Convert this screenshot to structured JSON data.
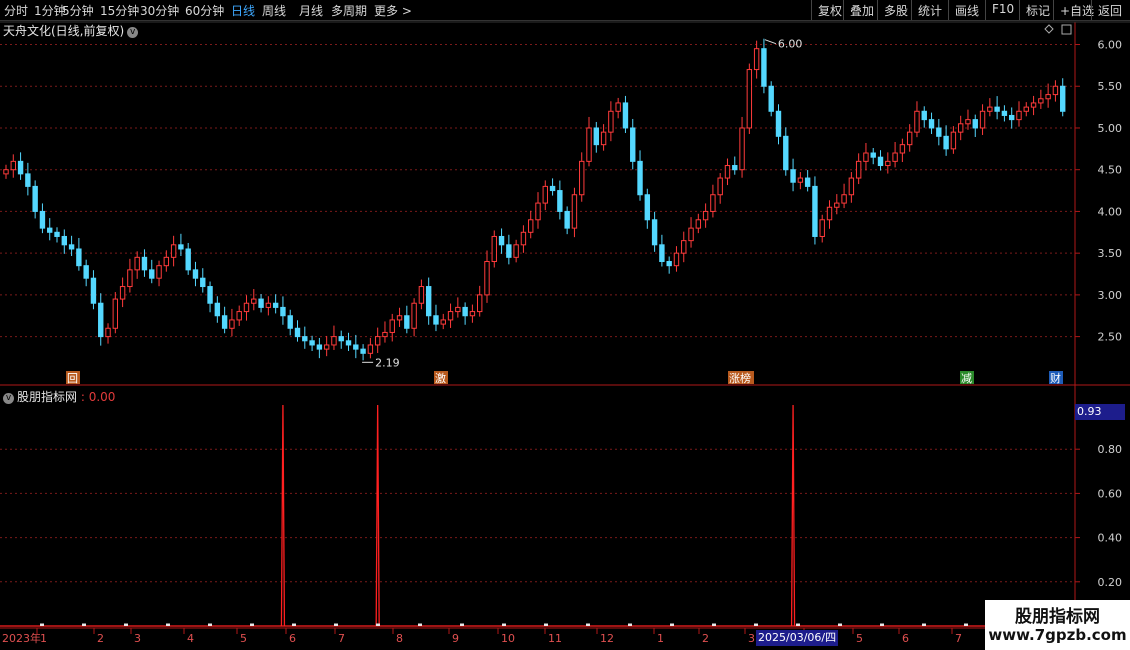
{
  "toolbar": {
    "left": [
      "分时",
      "1分钟",
      "5分钟",
      "15分钟",
      "30分钟",
      "60分钟",
      "日线",
      "周线",
      "月线",
      "多周期",
      "更多 >"
    ],
    "active": "日线",
    "right": [
      "复权",
      "叠加",
      "多股",
      "统计",
      "画线",
      "F10",
      "标记",
      "+自选",
      "返回"
    ]
  },
  "main": {
    "title": "天舟文化(日线,前复权)",
    "high_label": "6.00",
    "low_label": "2.19",
    "yaxis": [
      "6.00",
      "5.50",
      "5.00",
      "4.50",
      "4.00",
      "3.50",
      "3.00",
      "2.50"
    ],
    "tags": [
      {
        "text": "回",
        "color": "#b85a1e"
      },
      {
        "text": "激",
        "color": "#b85a1e"
      },
      {
        "text": "涨榜",
        "color": "#b85a1e"
      },
      {
        "text": "减",
        "color": "#2a8a2a"
      },
      {
        "text": "财",
        "color": "#1e5cb8"
      }
    ]
  },
  "indicator": {
    "name": "股朋指标网",
    "value": ": 0.00",
    "current": "0.93",
    "yaxis": [
      "0.80",
      "0.60",
      "0.40",
      "0.20"
    ]
  },
  "xaxis": {
    "labels": [
      "2023年",
      "1",
      "2",
      "3",
      "4",
      "5",
      "6",
      "7",
      "8",
      "9",
      "10",
      "11",
      "12",
      "1",
      "2",
      "3",
      "4",
      "5",
      "6",
      "7"
    ],
    "cursor_date": "2025/03/06/四"
  },
  "watermark": {
    "title": "股朋指标网",
    "url": "www.7gpzb.com"
  },
  "chart_data": {
    "type": "candlestick+line",
    "price": {
      "ylim": [
        2.1,
        6.15
      ],
      "close": [
        4.5,
        4.6,
        4.45,
        4.3,
        4.0,
        3.8,
        3.75,
        3.7,
        3.6,
        3.55,
        3.35,
        3.2,
        2.9,
        2.5,
        2.6,
        2.95,
        3.1,
        3.3,
        3.45,
        3.3,
        3.2,
        3.35,
        3.45,
        3.6,
        3.55,
        3.3,
        3.2,
        3.1,
        2.9,
        2.75,
        2.6,
        2.7,
        2.8,
        2.9,
        2.95,
        2.85,
        2.9,
        2.85,
        2.75,
        2.6,
        2.5,
        2.45,
        2.4,
        2.35,
        2.4,
        2.5,
        2.45,
        2.4,
        2.35,
        2.3,
        2.4,
        2.5,
        2.55,
        2.7,
        2.75,
        2.6,
        2.9,
        3.1,
        2.75,
        2.65,
        2.7,
        2.8,
        2.85,
        2.75,
        2.8,
        3.0,
        3.4,
        3.7,
        3.6,
        3.45,
        3.6,
        3.75,
        3.9,
        4.1,
        4.3,
        4.25,
        4.0,
        3.8,
        4.2,
        4.6,
        5.0,
        4.8,
        4.95,
        5.2,
        5.3,
        5.0,
        4.6,
        4.2,
        3.9,
        3.6,
        3.4,
        3.35,
        3.5,
        3.65,
        3.8,
        3.9,
        4.0,
        4.2,
        4.4,
        4.55,
        4.5,
        5.0,
        5.7,
        5.95,
        5.5,
        5.2,
        4.9,
        4.5,
        4.35,
        4.4,
        4.3,
        3.7,
        3.9,
        4.05,
        4.1,
        4.2,
        4.4,
        4.6,
        4.7,
        4.65,
        4.55,
        4.6,
        4.7,
        4.8,
        4.95,
        5.2,
        5.1,
        5.0,
        4.9,
        4.75,
        4.95,
        5.05,
        5.1,
        5.0,
        5.2,
        5.25,
        5.2,
        5.15,
        5.1,
        5.2,
        5.25,
        5.3,
        5.35,
        5.4,
        5.5,
        5.2
      ],
      "annotations": [
        {
          "label": "6.00",
          "type": "high"
        },
        {
          "label": "2.19",
          "type": "low"
        }
      ]
    },
    "indicator": {
      "ylim": [
        0,
        1.0
      ],
      "spikes": [
        {
          "index": 38,
          "value": 1.0
        },
        {
          "index": 51,
          "value": 1.0
        },
        {
          "index": 108,
          "value": 1.0
        }
      ],
      "baseline": 0.0
    }
  }
}
